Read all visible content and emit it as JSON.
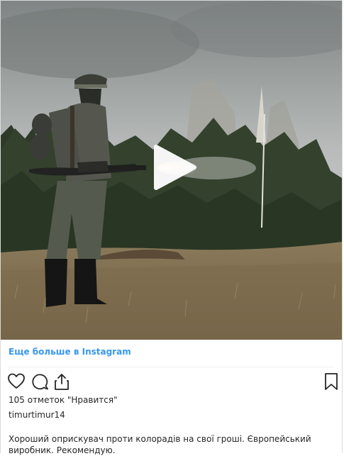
{
  "post": {
    "more_link": "Еще больше в Instagram",
    "likes": "105 отметок \"Нравится\"",
    "username": "timurtimur14",
    "caption": "Хороший оприскувач проти колорадів на свої гроші. Європейський виробник. Рекомендую."
  },
  "icons": {
    "like": "heart-icon",
    "comment": "comment-icon",
    "share": "share-icon",
    "save": "bookmark-icon",
    "play": "play-icon"
  },
  "colors": {
    "link": "#3897f0",
    "text": "#262626",
    "border": "#dbdbdb"
  }
}
